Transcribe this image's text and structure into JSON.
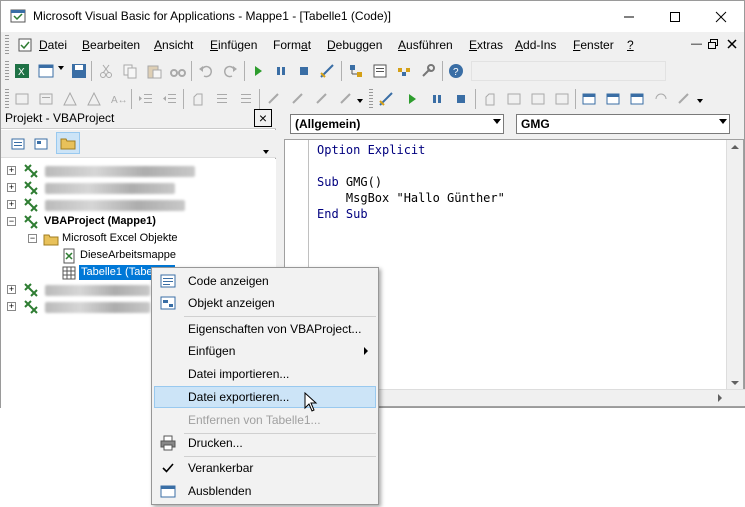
{
  "window": {
    "title": "Microsoft Visual Basic for Applications - Mappe1 - [Tabelle1 (Code)]"
  },
  "menu": [
    {
      "label": "Datei",
      "u": "D",
      "rest": "atei"
    },
    {
      "label": "Bearbeiten",
      "u": "B",
      "rest": "earbeiten"
    },
    {
      "label": "Ansicht",
      "u": "A",
      "rest": "nsicht"
    },
    {
      "label": "Einfügen",
      "u": "E",
      "rest": "infügen"
    },
    {
      "label": "Format",
      "u": "",
      "rest": "Format"
    },
    {
      "label": "Debuggen",
      "u": "",
      "rest": "Debuggen"
    },
    {
      "label": "Ausführen",
      "u": "",
      "rest": "Ausführen"
    },
    {
      "label": "Extras",
      "u": "",
      "rest": "Extras"
    },
    {
      "label": "Add-Ins",
      "u": "",
      "rest": "Add-Ins"
    },
    {
      "label": "Fenster",
      "u": "F",
      "rest": "enster"
    },
    {
      "label": "?",
      "u": "?",
      "rest": ""
    }
  ],
  "project": {
    "title": "Projekt - VBAProject",
    "close_label": "×",
    "vbaproject_label": "VBAProject (Mappe1)",
    "excel_objects_label": "Microsoft Excel Objekte",
    "workbook_label": "DieseArbeitsmappe",
    "sheet_label": "Tabelle1 (Tabelle1)"
  },
  "code": {
    "object_combo": "(Allgemein)",
    "proc_combo": "GMG",
    "lines": [
      "Option Explicit",
      "",
      "Sub GMG()",
      "    MsgBox \"Hallo Günther\"",
      "End Sub"
    ]
  },
  "context_menu": {
    "code_anzeigen": "Code anzeigen",
    "objekt_anzeigen": "Objekt anzeigen",
    "eigenschaften": "Eigenschaften von VBAProject...",
    "einfuegen": "Einfügen",
    "importieren": "Datei importieren...",
    "exportieren": "Datei exportieren...",
    "entfernen": "Entfernen von Tabelle1...",
    "drucken": "Drucken...",
    "verankerbar": "Verankerbar",
    "ausblenden": "Ausblenden"
  },
  "colors": {
    "highlight": "#cce4f7",
    "selection": "#0078d7",
    "keyword": "#00007f"
  }
}
